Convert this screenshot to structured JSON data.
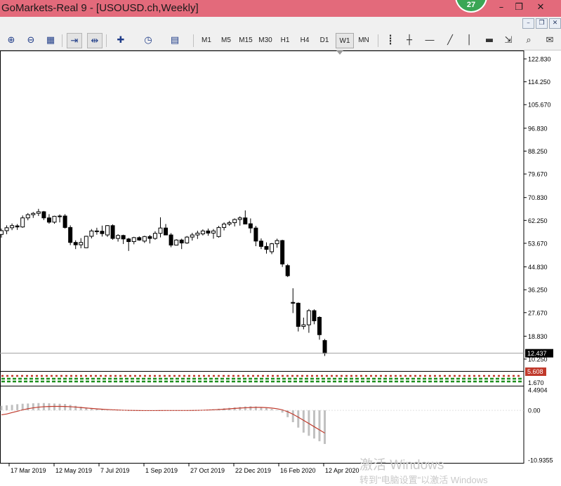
{
  "window": {
    "title": "GoMarkets-Real 9 - [USOUSD.ch,Weekly]",
    "badge": "27",
    "minimize_icon": "minimize-icon",
    "restore_icon": "restore-icon",
    "close_icon": "close-icon"
  },
  "toolbar": {
    "tools": [
      {
        "name": "zoom-in-button",
        "icon": "zoom-in-icon",
        "glyph": "⊕"
      },
      {
        "name": "zoom-out-button",
        "icon": "zoom-out-icon",
        "glyph": "⊖"
      },
      {
        "name": "tile-windows-button",
        "icon": "tile-windows-icon",
        "glyph": "▦"
      },
      {
        "name": "auto-scroll-button",
        "icon": "auto-scroll-icon",
        "glyph": "⇥"
      },
      {
        "name": "chart-shift-button",
        "icon": "chart-shift-icon",
        "glyph": "⇹"
      },
      {
        "name": "indicators-button",
        "icon": "indicators-icon",
        "glyph": "✚"
      },
      {
        "name": "periods-button",
        "icon": "clock-icon",
        "glyph": "◷"
      },
      {
        "name": "templates-button",
        "icon": "templates-icon",
        "glyph": "▤"
      }
    ],
    "timeframes": [
      "M1",
      "M5",
      "M15",
      "M30",
      "H1",
      "H4",
      "D1",
      "W1",
      "MN"
    ],
    "active_timeframe": "W1",
    "draw_tools": [
      {
        "name": "period-separators-button",
        "icon": "grid-icon",
        "glyph": "┋"
      },
      {
        "name": "crosshair-button",
        "icon": "crosshair-icon",
        "glyph": "┼"
      },
      {
        "name": "horizontal-line-button",
        "icon": "horizontal-line-icon",
        "glyph": "―"
      },
      {
        "name": "trendline-button",
        "icon": "trendline-icon",
        "glyph": "╱"
      },
      {
        "name": "vertical-line-button",
        "icon": "vertical-line-icon",
        "glyph": "│"
      },
      {
        "name": "rectangle-button",
        "icon": "rectangle-icon",
        "glyph": "▬"
      },
      {
        "name": "arrows-button",
        "icon": "arrows-icon",
        "glyph": "⇲"
      },
      {
        "name": "search-button",
        "icon": "search-icon",
        "glyph": "⌕"
      },
      {
        "name": "chat-button",
        "icon": "chat-icon",
        "glyph": "✉"
      }
    ]
  },
  "watermark": {
    "line1": "激活 Windows",
    "line2": "转到\"电脑设置\"以激活 Windows"
  },
  "colors": {
    "candle_up": "#ffffff",
    "candle_down": "#000000",
    "macd_hist": "#c0c0c0",
    "signal_line": "#c0392b",
    "price_tag_bg": "#000000",
    "indicator_tag_bg": "#c0392b",
    "dash_green": "#1f8f1f",
    "dash_red": "#c0392b"
  },
  "chart_data": [
    {
      "type": "candlestick",
      "symbol": "USOUSD.ch",
      "timeframe": "Weekly",
      "y_ticks": [
        "122.830",
        "114.250",
        "105.670",
        "96.830",
        "88.250",
        "79.670",
        "70.830",
        "62.250",
        "53.670",
        "44.830",
        "36.250",
        "27.670",
        "18.830",
        "10.250"
      ],
      "ylim": [
        10.25,
        122.83
      ],
      "current_price": "12.437",
      "x_ticks": [
        "17 Mar 2019",
        "12 May 2019",
        "7 Jul 2019",
        "1 Sep 2019",
        "27 Oct 2019",
        "22 Dec 2019",
        "16 Feb 2020",
        "12 Apr 2020"
      ],
      "candles": [
        {
          "o": 57.0,
          "h": 59.2,
          "l": 55.8,
          "c": 58.4
        },
        {
          "o": 58.4,
          "h": 60.4,
          "l": 57.1,
          "c": 59.5
        },
        {
          "o": 59.5,
          "h": 61.1,
          "l": 58.6,
          "c": 60.3
        },
        {
          "o": 60.2,
          "h": 60.9,
          "l": 58.7,
          "c": 59.8
        },
        {
          "o": 59.8,
          "h": 64.1,
          "l": 59.5,
          "c": 63.2
        },
        {
          "o": 63.2,
          "h": 65.0,
          "l": 62.3,
          "c": 64.4
        },
        {
          "o": 64.4,
          "h": 65.4,
          "l": 63.2,
          "c": 64.9
        },
        {
          "o": 64.9,
          "h": 66.6,
          "l": 63.9,
          "c": 65.5
        },
        {
          "o": 65.5,
          "h": 65.8,
          "l": 62.4,
          "c": 63.2
        },
        {
          "o": 63.2,
          "h": 64.6,
          "l": 61.0,
          "c": 61.6
        },
        {
          "o": 61.6,
          "h": 64.0,
          "l": 61.0,
          "c": 63.8
        },
        {
          "o": 63.8,
          "h": 64.5,
          "l": 61.5,
          "c": 63.9
        },
        {
          "o": 63.9,
          "h": 64.6,
          "l": 59.2,
          "c": 59.6
        },
        {
          "o": 59.6,
          "h": 60.4,
          "l": 53.0,
          "c": 54.0
        },
        {
          "o": 54.0,
          "h": 54.8,
          "l": 51.5,
          "c": 53.1
        },
        {
          "o": 53.1,
          "h": 55.6,
          "l": 51.8,
          "c": 54.0
        },
        {
          "o": 52.0,
          "h": 56.5,
          "l": 51.9,
          "c": 56.3
        },
        {
          "o": 56.3,
          "h": 59.0,
          "l": 55.5,
          "c": 58.3
        },
        {
          "o": 58.3,
          "h": 59.5,
          "l": 56.9,
          "c": 58.2
        },
        {
          "o": 58.2,
          "h": 60.3,
          "l": 56.2,
          "c": 57.3
        },
        {
          "o": 56.8,
          "h": 60.5,
          "l": 56.1,
          "c": 60.3
        },
        {
          "o": 60.3,
          "h": 60.8,
          "l": 55.0,
          "c": 55.5
        },
        {
          "o": 55.5,
          "h": 57.1,
          "l": 54.3,
          "c": 56.6
        },
        {
          "o": 56.6,
          "h": 56.9,
          "l": 53.4,
          "c": 55.3
        },
        {
          "o": 55.3,
          "h": 55.7,
          "l": 50.8,
          "c": 54.3
        },
        {
          "o": 54.3,
          "h": 56.1,
          "l": 53.3,
          "c": 55.8
        },
        {
          "o": 55.8,
          "h": 56.3,
          "l": 54.6,
          "c": 54.9
        },
        {
          "o": 54.5,
          "h": 56.5,
          "l": 53.8,
          "c": 56.2
        },
        {
          "o": 56.2,
          "h": 56.8,
          "l": 53.6,
          "c": 55.5
        },
        {
          "o": 55.5,
          "h": 58.2,
          "l": 55.0,
          "c": 57.4
        },
        {
          "o": 57.4,
          "h": 63.4,
          "l": 55.9,
          "c": 59.4
        },
        {
          "o": 59.4,
          "h": 60.9,
          "l": 56.9,
          "c": 56.8
        },
        {
          "o": 56.8,
          "h": 57.5,
          "l": 52.2,
          "c": 53.0
        },
        {
          "o": 53.0,
          "h": 55.2,
          "l": 52.9,
          "c": 54.9
        },
        {
          "o": 54.9,
          "h": 55.4,
          "l": 51.5,
          "c": 53.8
        },
        {
          "o": 53.8,
          "h": 56.4,
          "l": 53.5,
          "c": 56.0
        },
        {
          "o": 56.0,
          "h": 57.6,
          "l": 54.7,
          "c": 56.8
        },
        {
          "o": 56.8,
          "h": 58.4,
          "l": 55.3,
          "c": 57.5
        },
        {
          "o": 57.2,
          "h": 58.9,
          "l": 56.6,
          "c": 58.3
        },
        {
          "o": 58.3,
          "h": 59.2,
          "l": 56.5,
          "c": 57.5
        },
        {
          "o": 57.5,
          "h": 59.0,
          "l": 55.4,
          "c": 58.3
        },
        {
          "o": 56.2,
          "h": 60.2,
          "l": 55.8,
          "c": 59.6
        },
        {
          "o": 59.6,
          "h": 61.5,
          "l": 58.5,
          "c": 60.9
        },
        {
          "o": 60.9,
          "h": 62.1,
          "l": 60.2,
          "c": 61.4
        },
        {
          "o": 61.4,
          "h": 63.0,
          "l": 60.0,
          "c": 62.6
        },
        {
          "o": 62.6,
          "h": 63.8,
          "l": 60.3,
          "c": 63.2
        },
        {
          "o": 63.2,
          "h": 66.0,
          "l": 61.0,
          "c": 60.9
        },
        {
          "o": 61.0,
          "h": 63.0,
          "l": 57.5,
          "c": 59.4
        },
        {
          "o": 59.4,
          "h": 60.2,
          "l": 52.6,
          "c": 54.5
        },
        {
          "o": 54.5,
          "h": 55.5,
          "l": 51.5,
          "c": 52.5
        },
        {
          "o": 52.5,
          "h": 54.0,
          "l": 49.8,
          "c": 51.4
        },
        {
          "o": 50.5,
          "h": 53.8,
          "l": 49.6,
          "c": 53.5
        },
        {
          "o": 53.5,
          "h": 55.4,
          "l": 52.0,
          "c": 54.7
        },
        {
          "o": 54.7,
          "h": 55.0,
          "l": 44.8,
          "c": 45.9
        },
        {
          "o": 45.3,
          "h": 45.9,
          "l": 41.0,
          "c": 41.5
        },
        {
          "o": 31.5,
          "h": 36.8,
          "l": 27.5,
          "c": 31.2
        },
        {
          "o": 31.2,
          "h": 31.5,
          "l": 20.6,
          "c": 22.5
        },
        {
          "o": 22.5,
          "h": 25.8,
          "l": 21.4,
          "c": 23.1
        },
        {
          "o": 23.1,
          "h": 29.0,
          "l": 20.1,
          "c": 28.4
        },
        {
          "o": 28.4,
          "h": 28.9,
          "l": 23.3,
          "c": 24.6
        },
        {
          "o": 25.9,
          "h": 26.3,
          "l": 17.5,
          "c": 19.4
        },
        {
          "o": 17.2,
          "h": 17.8,
          "l": 11.4,
          "c": 12.4
        }
      ]
    },
    {
      "type": "bar",
      "indicator_value": "5.608",
      "y_ticks": [
        "1.670"
      ]
    },
    {
      "type": "bar",
      "y_ticks": [
        "4.4904",
        "0.00",
        "-10.9355"
      ],
      "ylim": [
        -10.9355,
        4.4904
      ],
      "series": [
        {
          "type": "bar",
          "values": [
            1.0,
            1.1,
            1.2,
            1.35,
            1.45,
            1.5,
            1.55,
            1.6,
            1.6,
            1.55,
            1.5,
            1.45,
            1.4,
            1.2,
            1.0,
            0.8,
            0.6,
            0.45,
            0.35,
            0.25,
            0.2,
            0.15,
            0.1,
            0.05,
            0.0,
            -0.05,
            -0.05,
            -0.05,
            -0.05,
            -0.05,
            0.0,
            0.0,
            0.0,
            -0.05,
            -0.05,
            -0.05,
            0.0,
            0.05,
            0.1,
            0.15,
            0.25,
            0.35,
            0.45,
            0.55,
            0.65,
            0.75,
            0.85,
            0.9,
            0.85,
            0.7,
            0.5,
            0.3,
            0.1,
            -0.5,
            -1.5,
            -2.6,
            -3.8,
            -4.9,
            -5.6,
            -6.2,
            -6.8,
            -7.4
          ]
        },
        {
          "type": "line",
          "values": [
            -1.0,
            -0.8,
            -0.5,
            -0.2,
            0.1,
            0.35,
            0.55,
            0.7,
            0.8,
            0.85,
            0.87,
            0.87,
            0.85,
            0.8,
            0.72,
            0.62,
            0.52,
            0.42,
            0.33,
            0.25,
            0.18,
            0.12,
            0.07,
            0.03,
            0.0,
            -0.02,
            -0.04,
            -0.05,
            -0.05,
            -0.05,
            -0.04,
            -0.03,
            -0.03,
            -0.03,
            -0.03,
            -0.03,
            -0.02,
            0.0,
            0.03,
            0.07,
            0.12,
            0.18,
            0.25,
            0.33,
            0.42,
            0.5,
            0.57,
            0.62,
            0.65,
            0.65,
            0.6,
            0.5,
            0.35,
            0.1,
            -0.3,
            -0.85,
            -1.5,
            -2.2,
            -2.9,
            -3.6,
            -4.3,
            -5.0
          ]
        }
      ]
    }
  ]
}
